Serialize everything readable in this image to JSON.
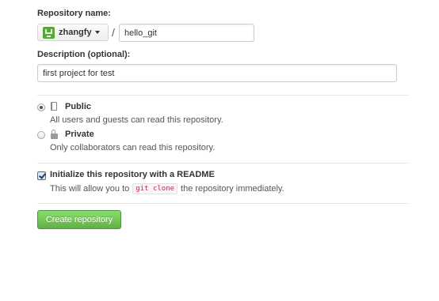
{
  "form": {
    "repo_name_label": "Repository name:",
    "owner": {
      "name": "zhangfy",
      "avatar_icon": "identicon-avatar",
      "caret_icon": "caret-down-icon"
    },
    "separator": "/",
    "repo_name_value": "hello_git",
    "description_label": "Description (optional):",
    "description_value": "first project for test",
    "visibility": {
      "selected": "public",
      "public": {
        "title": "Public",
        "description": "All users and guests can read this repository.",
        "icon": "repo-icon"
      },
      "private": {
        "title": "Private",
        "description": "Only collaborators can read this repository.",
        "icon": "lock-icon"
      }
    },
    "readme": {
      "checked": true,
      "title": "Initialize this repository with a README",
      "desc_before": "This will allow you to",
      "desc_code": "git clone",
      "desc_after": "the repository immediately."
    },
    "submit_label": "Create repository"
  },
  "colors": {
    "primary_button": "#60b044",
    "code_text": "#c7254e",
    "divider": "#e5e5e5"
  }
}
